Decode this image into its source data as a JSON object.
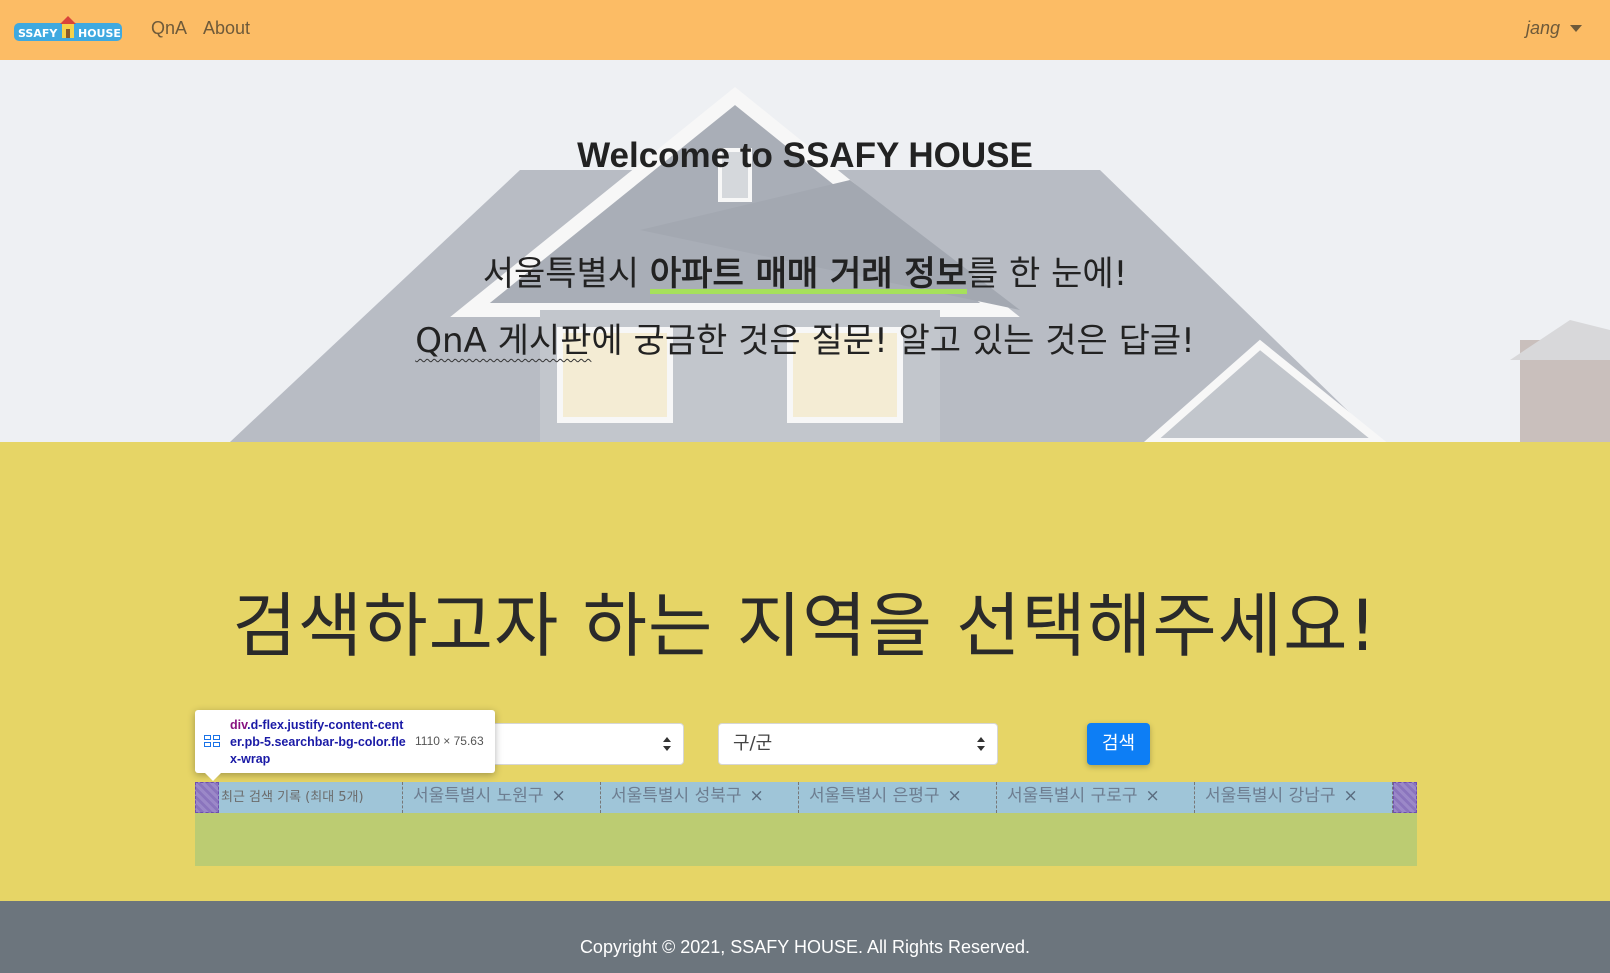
{
  "navbar": {
    "logo_text": "SSAFY HOUSE",
    "links": [
      {
        "label": "QnA"
      },
      {
        "label": "About"
      }
    ],
    "user": "jang"
  },
  "hero": {
    "title": "Welcome to SSAFY HOUSE",
    "line1_prefix": "서울특별시 ",
    "line1_strong": "아파트 매매 거래 정보",
    "line1_suffix": "를 한 눈에!",
    "line2_underlined": "QnA 게시판",
    "line2_rest": "에 궁금한 것은 질문! 알고 있는 것은 답글!"
  },
  "search": {
    "heading": "검색하고자 하는 지역을 선택해주세요!",
    "sido_value": "",
    "gugun_value": "구/군",
    "button_label": "검색",
    "recent_label": "최근 검색 기록 (최대 5개)",
    "recent_items": [
      {
        "label": "서울특별시 노원구"
      },
      {
        "label": "서울특별시 성북구"
      },
      {
        "label": "서울특별시 은평구"
      },
      {
        "label": "서울특별시 구로구"
      },
      {
        "label": "서울특별시 강남구"
      }
    ]
  },
  "devtools_tooltip": {
    "tag": "div",
    "classes": ".d-flex.justify-content-center.pb-5.searchbar-bg-color.flex-wrap",
    "size": "1110 × 75.63"
  },
  "footer": {
    "text": "Copyright © 2021, SSAFY HOUSE. All Rights Reserved."
  },
  "colors": {
    "navbar_bg": "#fcbc65",
    "search_bg": "#e6d566",
    "button_primary": "#0d7ef5",
    "footer_bg": "#6c757d",
    "highlight_underline": "#a6e05b"
  }
}
